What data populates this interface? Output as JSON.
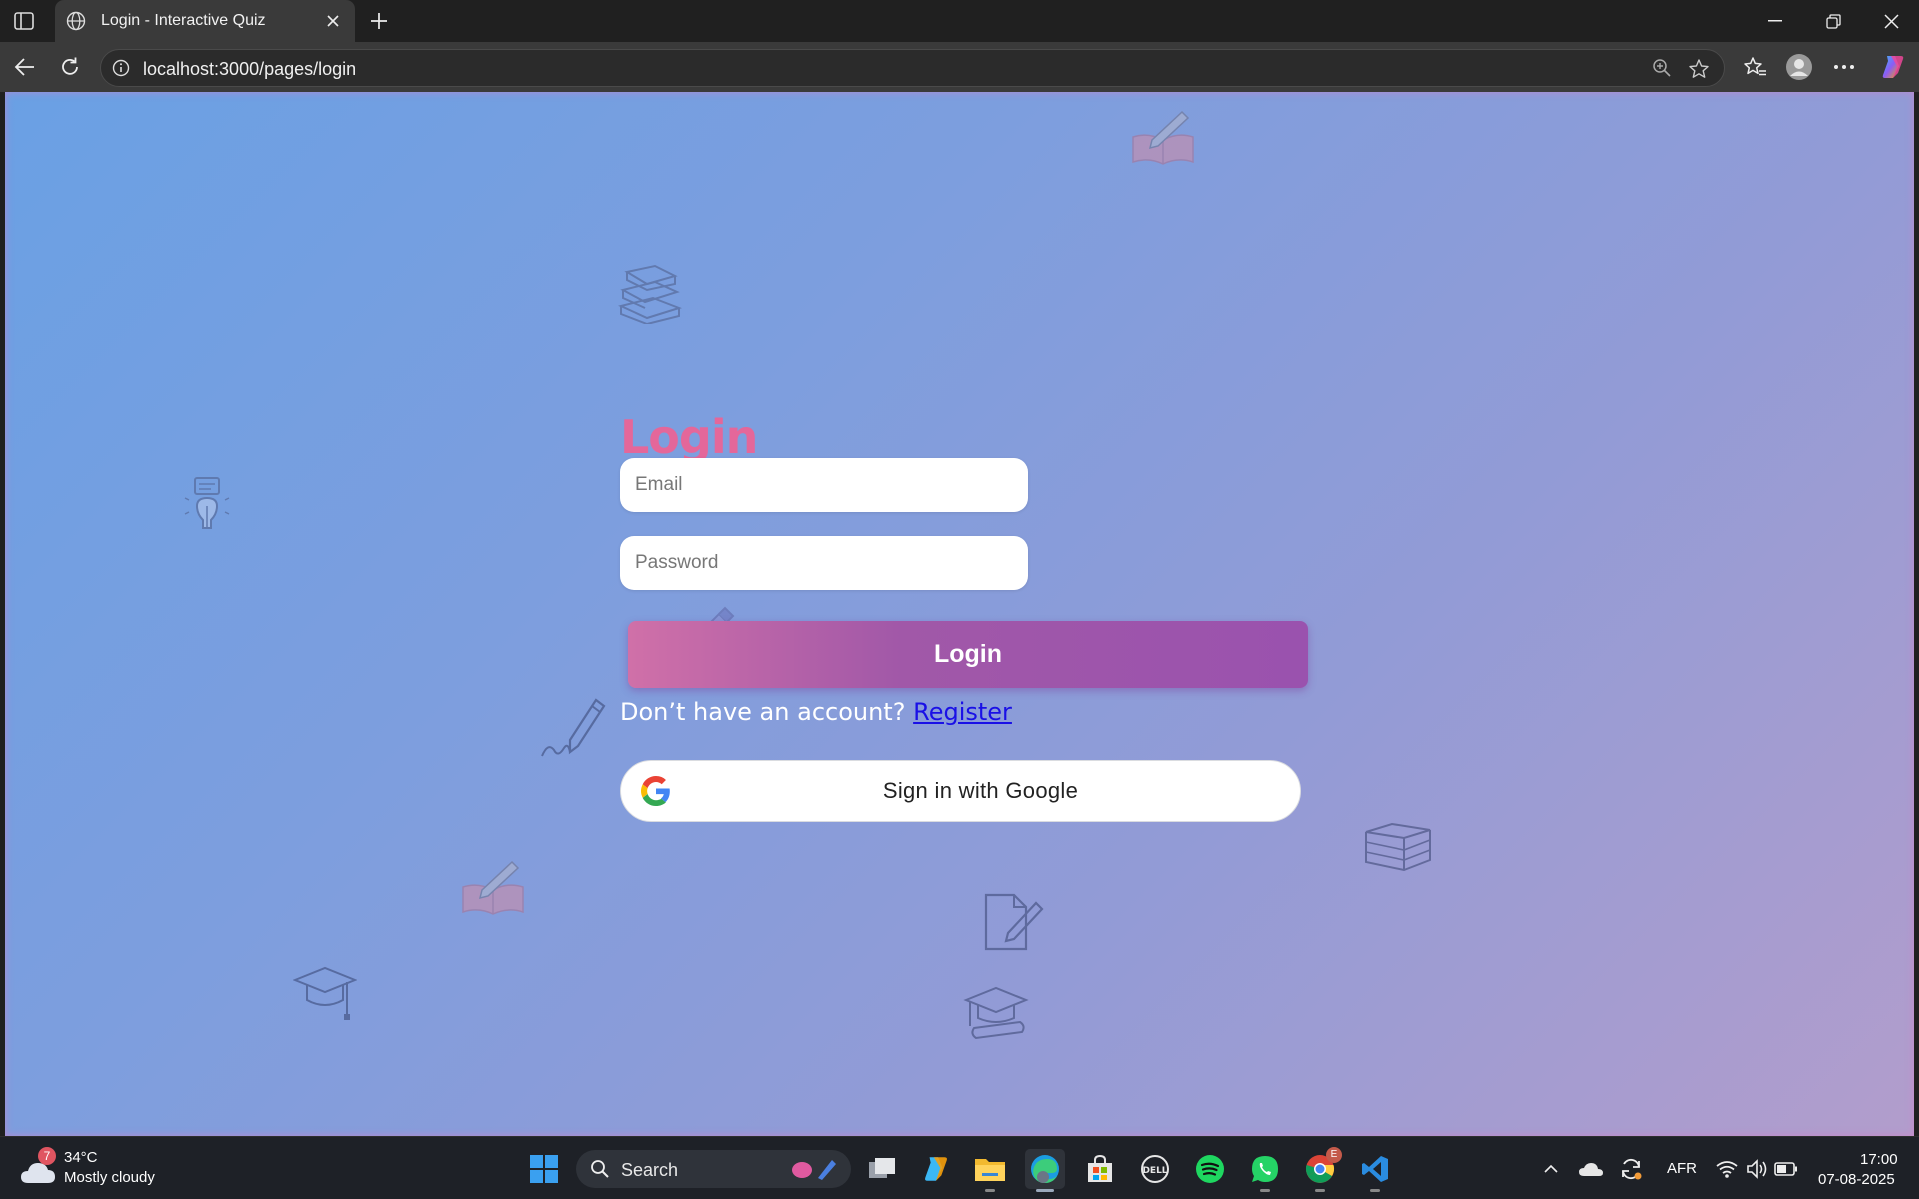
{
  "browser": {
    "tab_title": "Login - Interactive Quiz",
    "url": "localhost:3000/pages/login"
  },
  "login": {
    "heading": "Login",
    "email_placeholder": "Email",
    "password_placeholder": "Password",
    "submit_label": "Login",
    "no_account_text": "Don’t have an account?",
    "register_link": "Register",
    "google_label": "Sign in with Google"
  },
  "decorations": [
    "open-book-icon",
    "stacked-books-icon",
    "lightbulb-icon",
    "pencil-icon",
    "pen-signature-icon",
    "open-book-icon",
    "graduation-cap-icon",
    "document-pen-icon",
    "graduation-cap-diploma-icon",
    "bookshelf-icon"
  ],
  "colors": {
    "heading": "#e4679a",
    "login_button_start": "#d070a8",
    "login_button_end": "#9a52ae",
    "register_link": "#1a10e6",
    "background_start": "#6aa0e4",
    "background_end": "#b29dcc"
  },
  "taskbar": {
    "weather_badge": "7",
    "temperature": "34°C",
    "condition": "Mostly cloudy",
    "search_label": "Search",
    "language": "AFR",
    "time": "17:00",
    "date": "07-08-2025",
    "chrome_badge": "E",
    "apps": [
      "start-icon",
      "search",
      "task-view-icon",
      "copilot-icon",
      "file-explorer-icon",
      "edge-icon",
      "store-icon",
      "dell-icon",
      "spotify-icon",
      "whatsapp-icon",
      "chrome-icon",
      "vscode-icon"
    ]
  }
}
